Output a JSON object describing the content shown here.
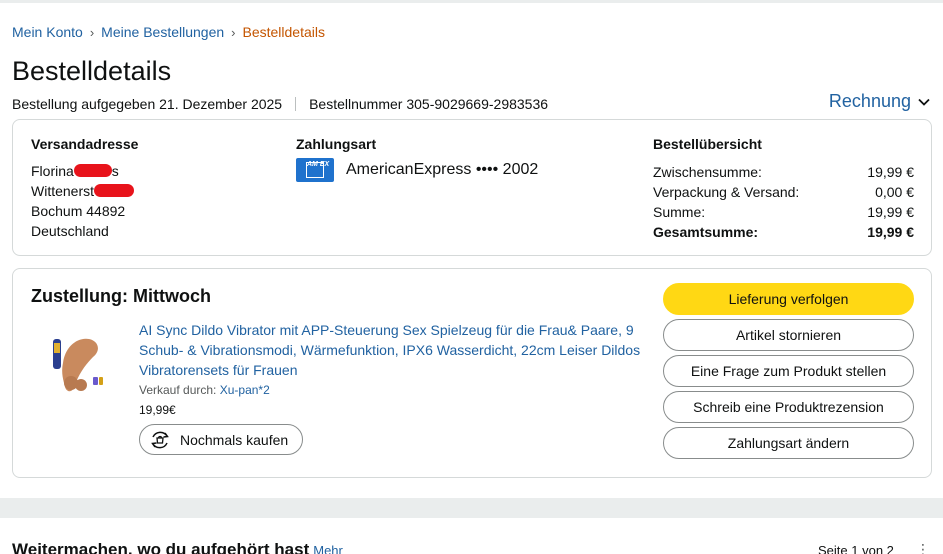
{
  "breadcrumb": {
    "items": [
      "Mein Konto",
      "Meine Bestellungen"
    ],
    "current": "Bestelldetails",
    "separator": "›"
  },
  "page_title": "Bestelldetails",
  "order_meta": {
    "placed": "Bestellung aufgegeben 21. Dezember 2025",
    "number": "Bestellnummer 305-9029669-2983536"
  },
  "invoice": {
    "label": "Rechnung",
    "icon": "chevron-down-icon"
  },
  "shipping": {
    "heading": "Versandadresse",
    "name_visible": "Florina",
    "name_suffix": "s",
    "street_visible": "Wittenerst",
    "city": "Bochum 44892",
    "country": "Deutschland"
  },
  "payment": {
    "heading": "Zahlungsart",
    "card_logo": "AM EX",
    "card_label": "AmericanExpress •••• 2002"
  },
  "summary": {
    "heading": "Bestellübersicht",
    "rows": [
      {
        "label": "Zwischensumme:",
        "amount": "19,99 €"
      },
      {
        "label": "Verpackung & Versand:",
        "amount": "0,00 €"
      },
      {
        "label": "Summe:",
        "amount": "19,99 €"
      },
      {
        "label": "Gesamtsumme:",
        "amount": "19,99 €"
      }
    ]
  },
  "delivery": {
    "title": "Zustellung: Mittwoch",
    "product": {
      "title": "AI Sync Dildo Vibrator mit APP-Steuerung Sex Spielzeug für die Frau& Paare, 9 Schub- & Vibrationsmodi, Wärmefunktion, IPX6 Wasserdicht, 22cm Leiser Dildos Vibratorensets für Frauen",
      "seller_prefix": "Verkauf durch:",
      "seller_name": "Xu-pan*2",
      "price": "19,99€"
    },
    "buy_again": "Nochmals kaufen",
    "actions": [
      "Lieferung verfolgen",
      "Artikel stornieren",
      "Eine Frage zum Produkt stellen",
      "Schreib eine Produktrezension",
      "Zahlungsart ändern"
    ]
  },
  "continue_section": {
    "title": "Weitermachen, wo du aufgehört hast",
    "more_link": "Mehr",
    "pager": "Seite 1 von 2",
    "more_icon": "⋮"
  },
  "colors": {
    "link": "#2162a1",
    "breadcrumb_current": "#c45500",
    "primary_button": "#ffd814",
    "redaction": "#e8131b",
    "amex_blue": "#1f72cd"
  }
}
